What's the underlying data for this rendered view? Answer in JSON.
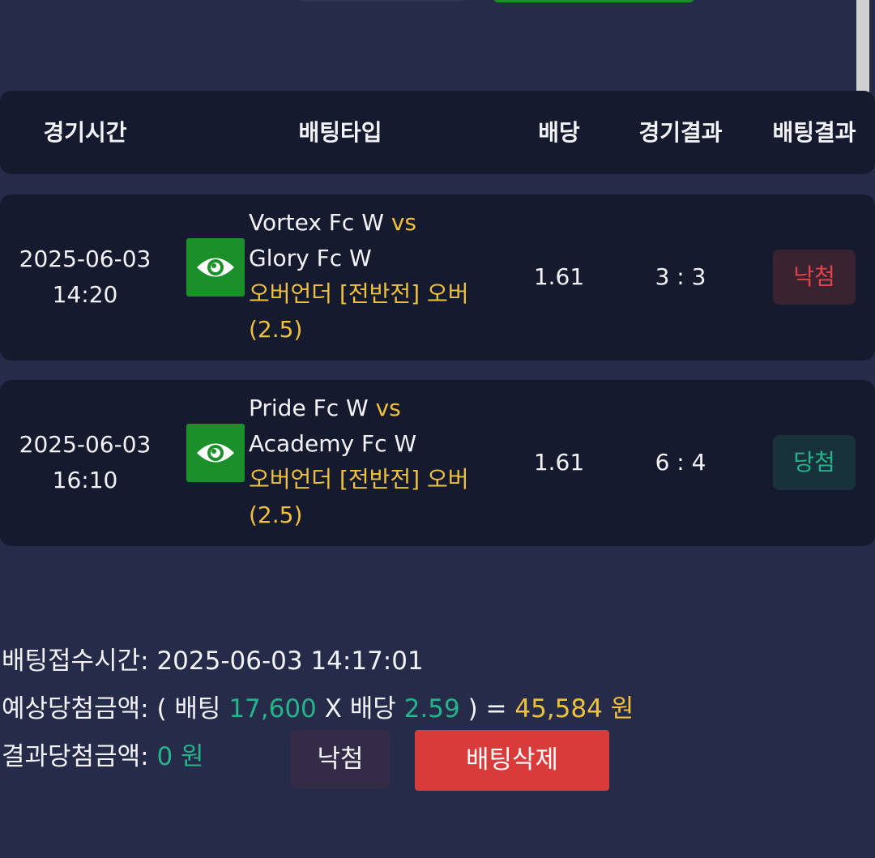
{
  "header": {
    "time": "경기시간",
    "bet_type": "배팅타입",
    "odds": "배당",
    "game_result": "경기결과",
    "bet_result": "배팅결과"
  },
  "matches": [
    {
      "date": "2025-06-03",
      "time": "14:20",
      "icon": "eye-icon",
      "home": "Vortex Fc W",
      "vs": "vs",
      "away": "Glory Fc W",
      "market_line1": "오버언더 [전반전] 오버",
      "market_line2": "(2.5)",
      "odds": "1.61",
      "score": "3 : 3",
      "result": "낙첨"
    },
    {
      "date": "2025-06-03",
      "time": "16:10",
      "icon": "eye-icon",
      "home": "Pride Fc W",
      "vs": "vs",
      "away": "Academy Fc W",
      "market_line1": "오버언더 [전반전] 오버",
      "market_line2": "(2.5)",
      "odds": "1.61",
      "score": "6 : 4",
      "result": "당첨"
    }
  ],
  "summary": {
    "accept_label": "배팅접수시간:",
    "accept_time": "2025-06-03 14:17:01",
    "expected_label": "예상당첨금액:",
    "open_paren": "(",
    "bet_label": "배팅",
    "bet_amount": "17,600",
    "x": "X",
    "odds_label": "배당",
    "total_odds": "2.59",
    "close_paren_eq": ") =",
    "expected_amount": "45,584",
    "won": "원",
    "result_label": "결과당첨금액:",
    "result_amount": "0",
    "result_won": "원"
  },
  "buttons": {
    "status": "낙첨",
    "delete": "배팅삭제"
  },
  "colors": {
    "background": "#252b48",
    "panel": "#161a2e",
    "accent_yellow": "#f0c23c",
    "accent_green": "#25b48a",
    "lose_red": "#e0434a",
    "delete_button": "#d93a3a",
    "icon_green": "#1b8f2a"
  }
}
